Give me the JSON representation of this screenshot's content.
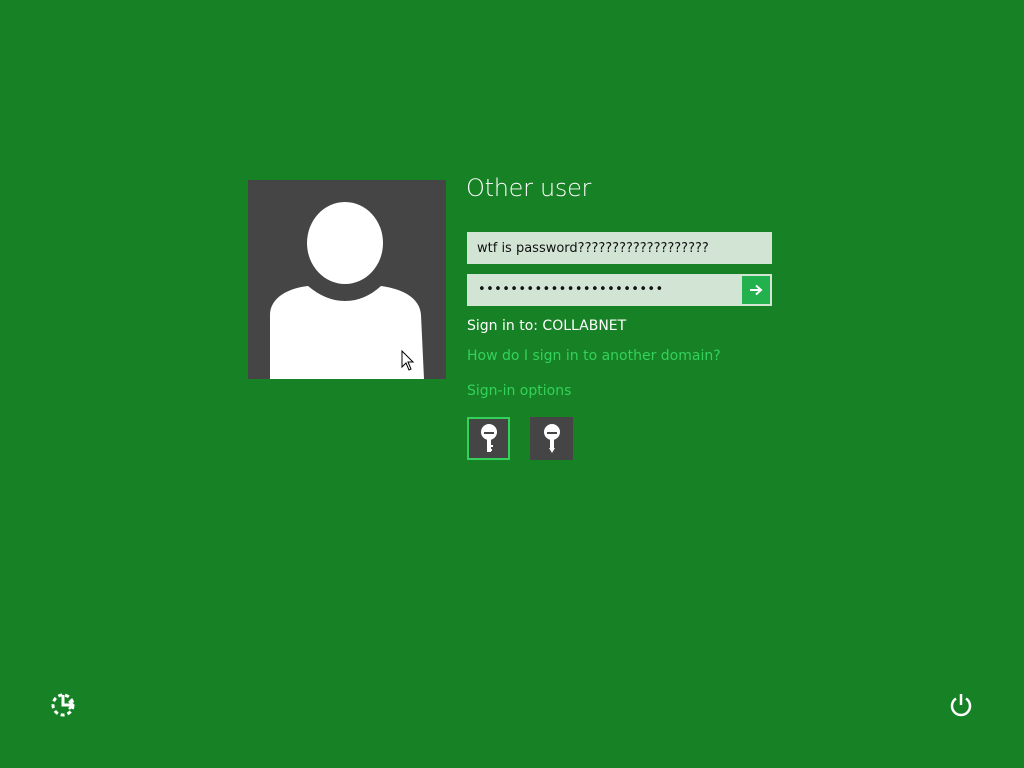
{
  "user": {
    "name": "Other user"
  },
  "username_field": {
    "value": "wtf is password???????????????????"
  },
  "password_field": {
    "masked_value": "•••••••••••••••••••••••",
    "submit_icon": "arrow-right-icon"
  },
  "sign_in_to": "Sign in to: COLLABNET",
  "links": {
    "domain_help": "How do I sign in to another domain?",
    "sign_in_options": "Sign-in options"
  },
  "sign_in_option_icons": [
    "key-icon",
    "key-icon"
  ],
  "bottom_icons": {
    "left": "ease-of-access-icon",
    "right": "power-icon"
  },
  "colors": {
    "background": "#178125",
    "tile": "#454545",
    "accent": "#34d25a",
    "field": "#d2e5d4",
    "submit": "#22b14c"
  }
}
